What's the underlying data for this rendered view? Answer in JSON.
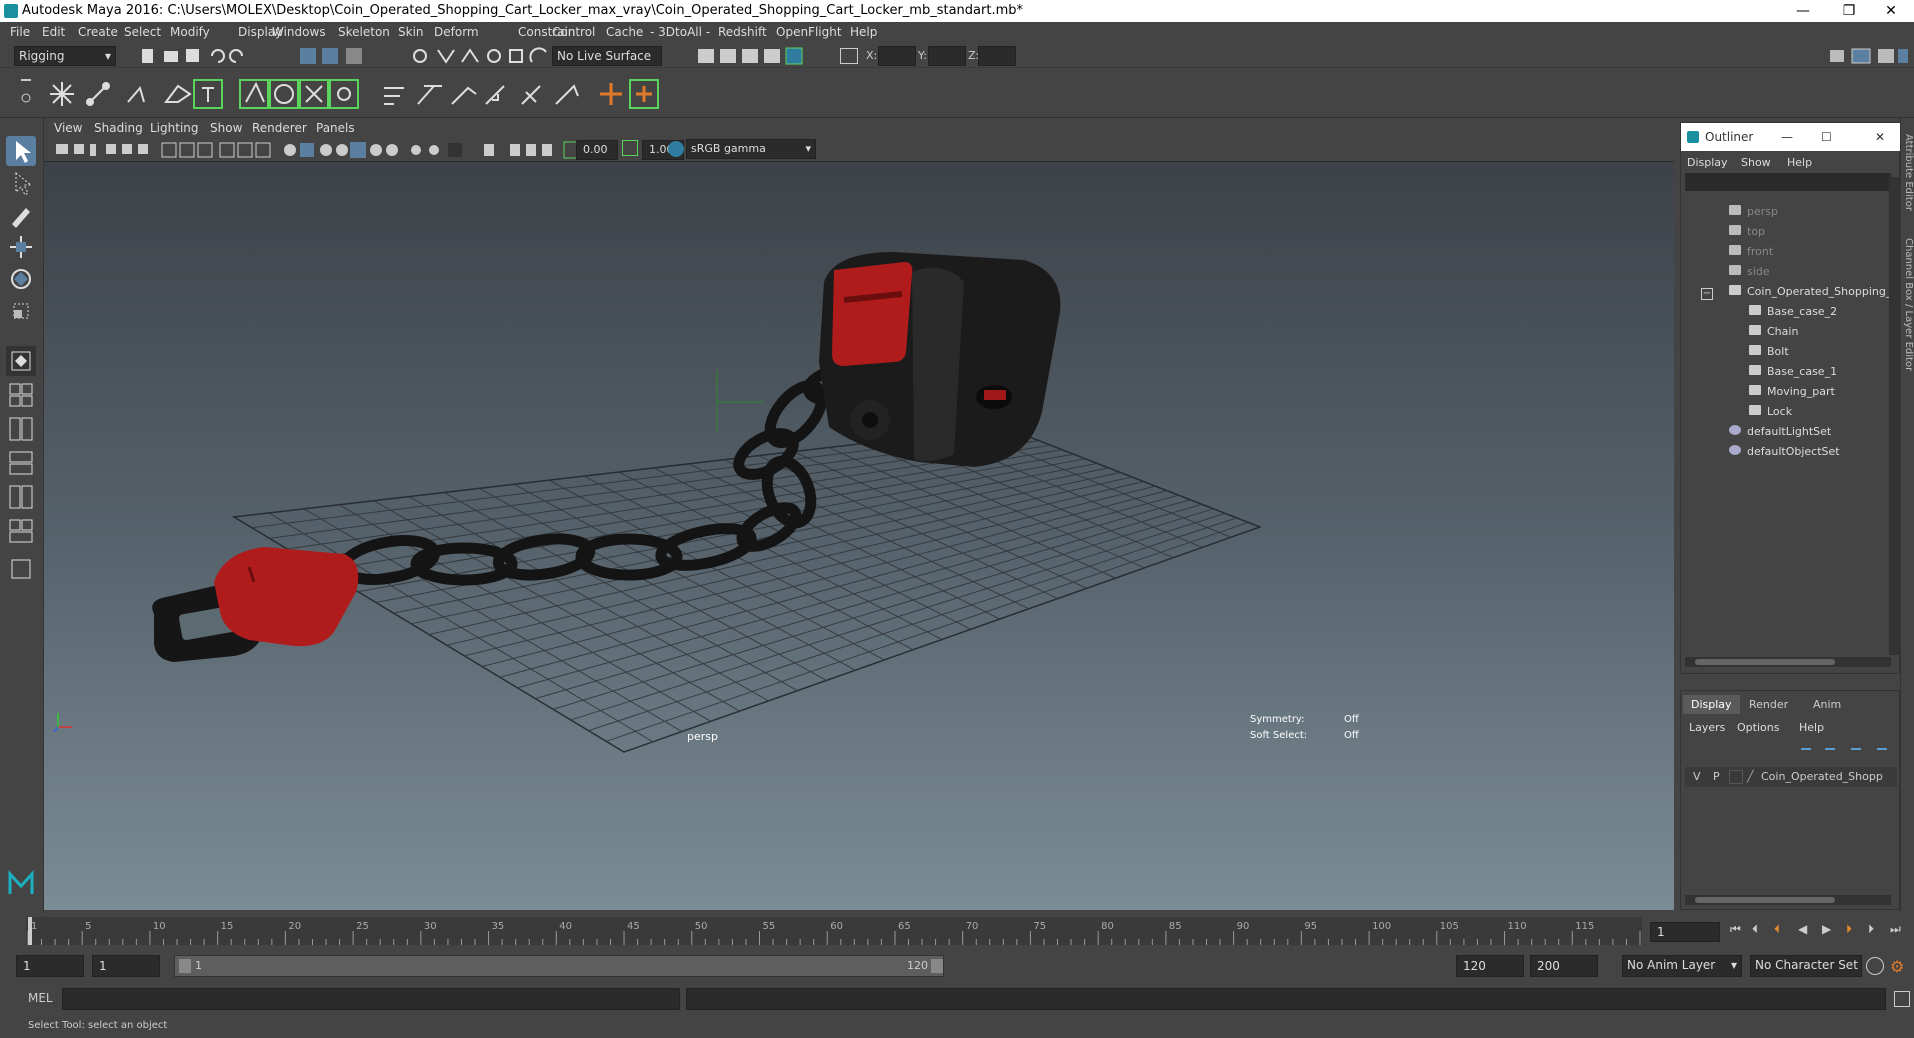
{
  "window": {
    "title": "Autodesk Maya 2016: C:\\Users\\MOLEX\\Desktop\\Coin_Operated_Shopping_Cart_Locker_max_vray\\Coin_Operated_Shopping_Cart_Locker_mb_standart.mb*",
    "minimize": "—",
    "restore": "❐",
    "close": "✕"
  },
  "menubar": [
    "File",
    "Edit",
    "Create",
    "Select",
    "Modify",
    "Display",
    "Windows",
    "Skeleton",
    "Skin",
    "Deform",
    "Constrain",
    "Control",
    "Cache",
    "- 3DtoAll -",
    "Redshift",
    "OpenFlight",
    "Help"
  ],
  "statusline": {
    "mode": "Rigging",
    "live_surface": "No Live Surface",
    "x_label": "X:",
    "y_label": "Y:",
    "z_label": "Z:"
  },
  "viewport_menu": [
    "View",
    "Shading",
    "Lighting",
    "Show",
    "Renderer",
    "Panels"
  ],
  "viewport_toolbar": {
    "exposure": "0.00",
    "gamma": "1.00",
    "colorspace": "sRGB gamma"
  },
  "viewport": {
    "camera": "persp",
    "symmetry_label": "Symmetry:",
    "symmetry_value": "Off",
    "soft_select_label": "Soft Select:",
    "soft_select_value": "Off"
  },
  "outliner": {
    "title": "Outliner",
    "menu": [
      "Display",
      "Show",
      "Help"
    ],
    "items": [
      {
        "label": "persp",
        "dim": true
      },
      {
        "label": "top",
        "dim": true
      },
      {
        "label": "front",
        "dim": true
      },
      {
        "label": "side",
        "dim": true
      },
      {
        "label": "Coin_Operated_Shopping_",
        "dim": false
      },
      {
        "label": "Base_case_2",
        "dim": false
      },
      {
        "label": "Chain",
        "dim": false
      },
      {
        "label": "Bolt",
        "dim": false
      },
      {
        "label": "Base_case_1",
        "dim": false
      },
      {
        "label": "Moving_part",
        "dim": false
      },
      {
        "label": "Lock",
        "dim": false
      },
      {
        "label": "defaultLightSet",
        "dim": false
      },
      {
        "label": "defaultObjectSet",
        "dim": false
      }
    ]
  },
  "layer_editor": {
    "tabs": [
      "Display",
      "Render",
      "Anim"
    ],
    "menu": [
      "Layers",
      "Options",
      "Help"
    ],
    "layer_v": "V",
    "layer_p": "P",
    "layer_name": "Coin_Operated_Shopp"
  },
  "side_tabs": {
    "attribute": "Attribute Editor",
    "channel": "Channel Box / Layer Editor"
  },
  "timeline": {
    "ticks": [
      "1",
      "5",
      "10",
      "15",
      "20",
      "25",
      "30",
      "35",
      "40",
      "45",
      "50",
      "55",
      "60",
      "65",
      "70",
      "75",
      "80",
      "85",
      "90",
      "95",
      "100",
      "105",
      "110",
      "115",
      "120"
    ],
    "current_frame": "1",
    "range_start": "1",
    "range_start2": "1",
    "range_slider_start": "1",
    "range_slider_end": "120",
    "range_end": "120",
    "range_end2": "200",
    "anim_layer": "No Anim Layer",
    "character_set": "No Character Set"
  },
  "command_line": {
    "label": "MEL"
  },
  "help_line": "Select Tool: select an object",
  "colors": {
    "accent_green": "#5ad45a",
    "lock_red": "#b01c1c",
    "plastic_black": "#1e1e1e"
  }
}
